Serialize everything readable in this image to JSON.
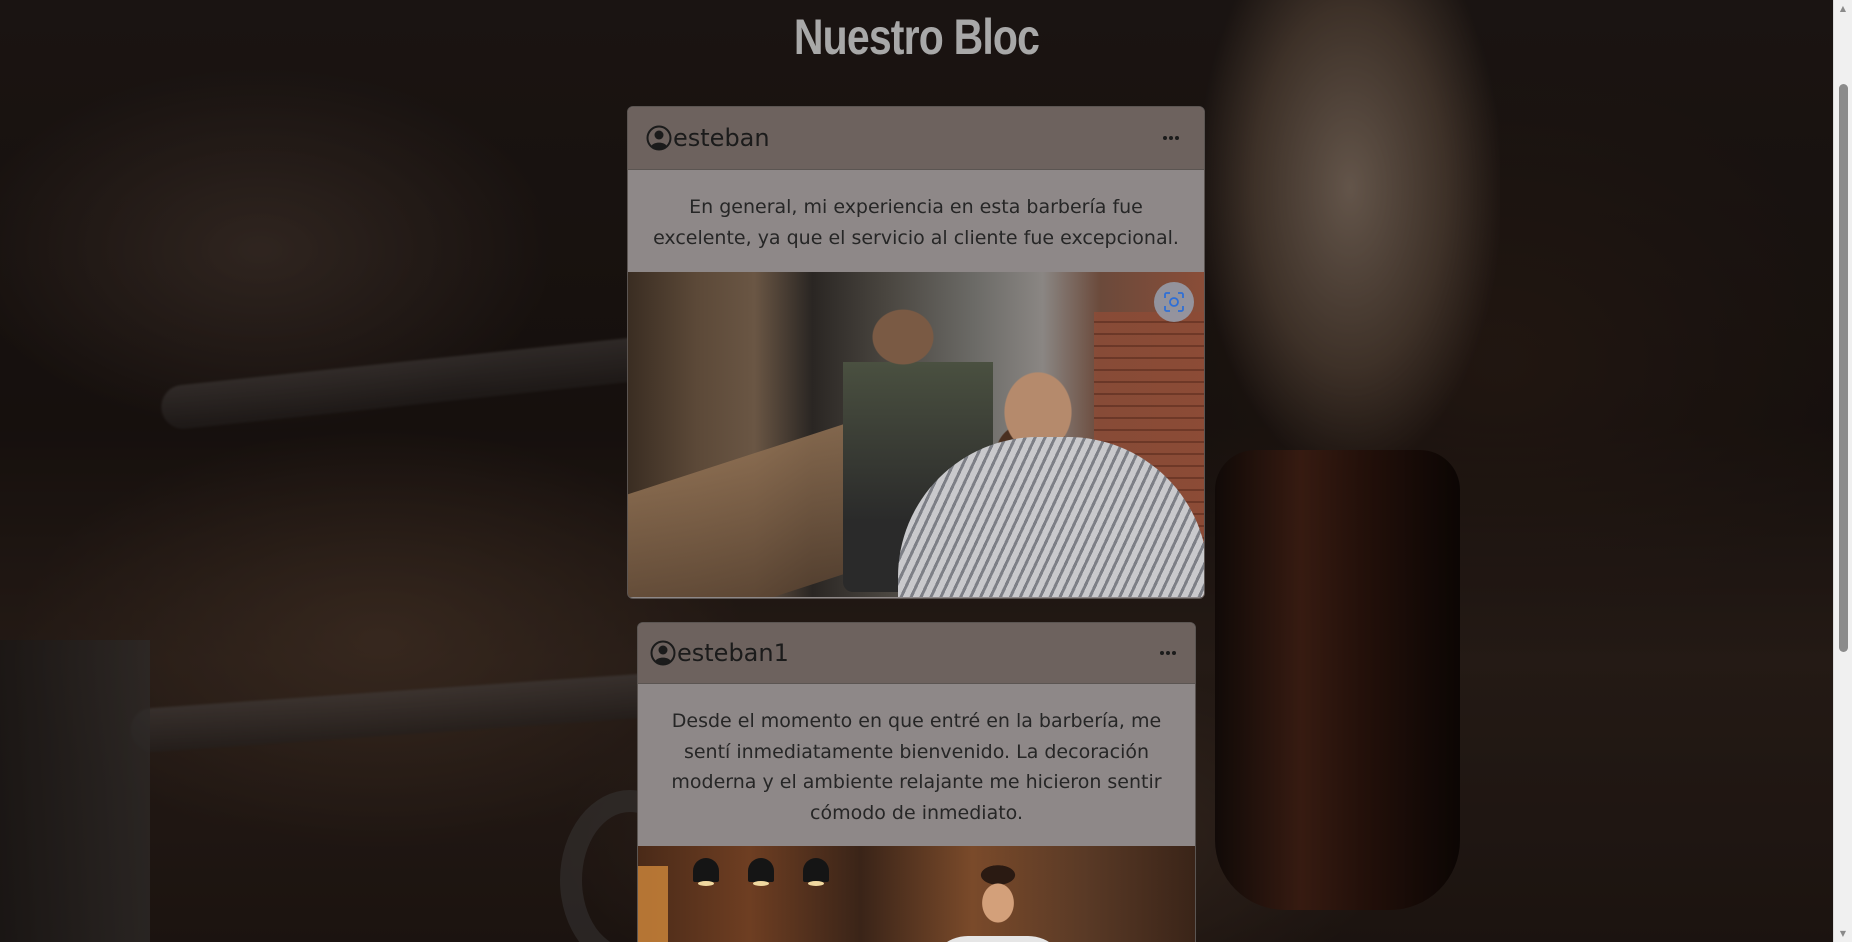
{
  "page": {
    "title": "Nuestro Bloc"
  },
  "posts": [
    {
      "username": "esteban",
      "user_icon": "user-circle-icon",
      "menu_icon": "more-horizontal-icon",
      "menu_label": "···",
      "text": "En general, mi experiencia en esta barbería fue excelente, ya que el servicio al cliente fue excepcional.",
      "image_alt": "Barbero recortando la barba a un cliente",
      "image_action_icon": "visual-search-icon"
    },
    {
      "username": "esteban1",
      "user_icon": "user-circle-icon",
      "menu_icon": "more-horizontal-icon",
      "menu_label": "···",
      "text": "Desde el momento en que entré en la barbería, me sentí inmediatamente bienvenido. La decoración moderna y el ambiente relajante me hicieron sentir cómodo de inmediato.",
      "image_alt": "Hombre sonriente en la barbería"
    }
  ],
  "scrollbar": {
    "up_icon": "scroll-up-arrow-icon",
    "down_icon": "scroll-down-arrow-icon",
    "position_fraction": 0.09
  },
  "colors": {
    "title": "#a8a8a8",
    "card_header": "#6d625e",
    "card_body": "#8e8888",
    "text": "#262626"
  }
}
